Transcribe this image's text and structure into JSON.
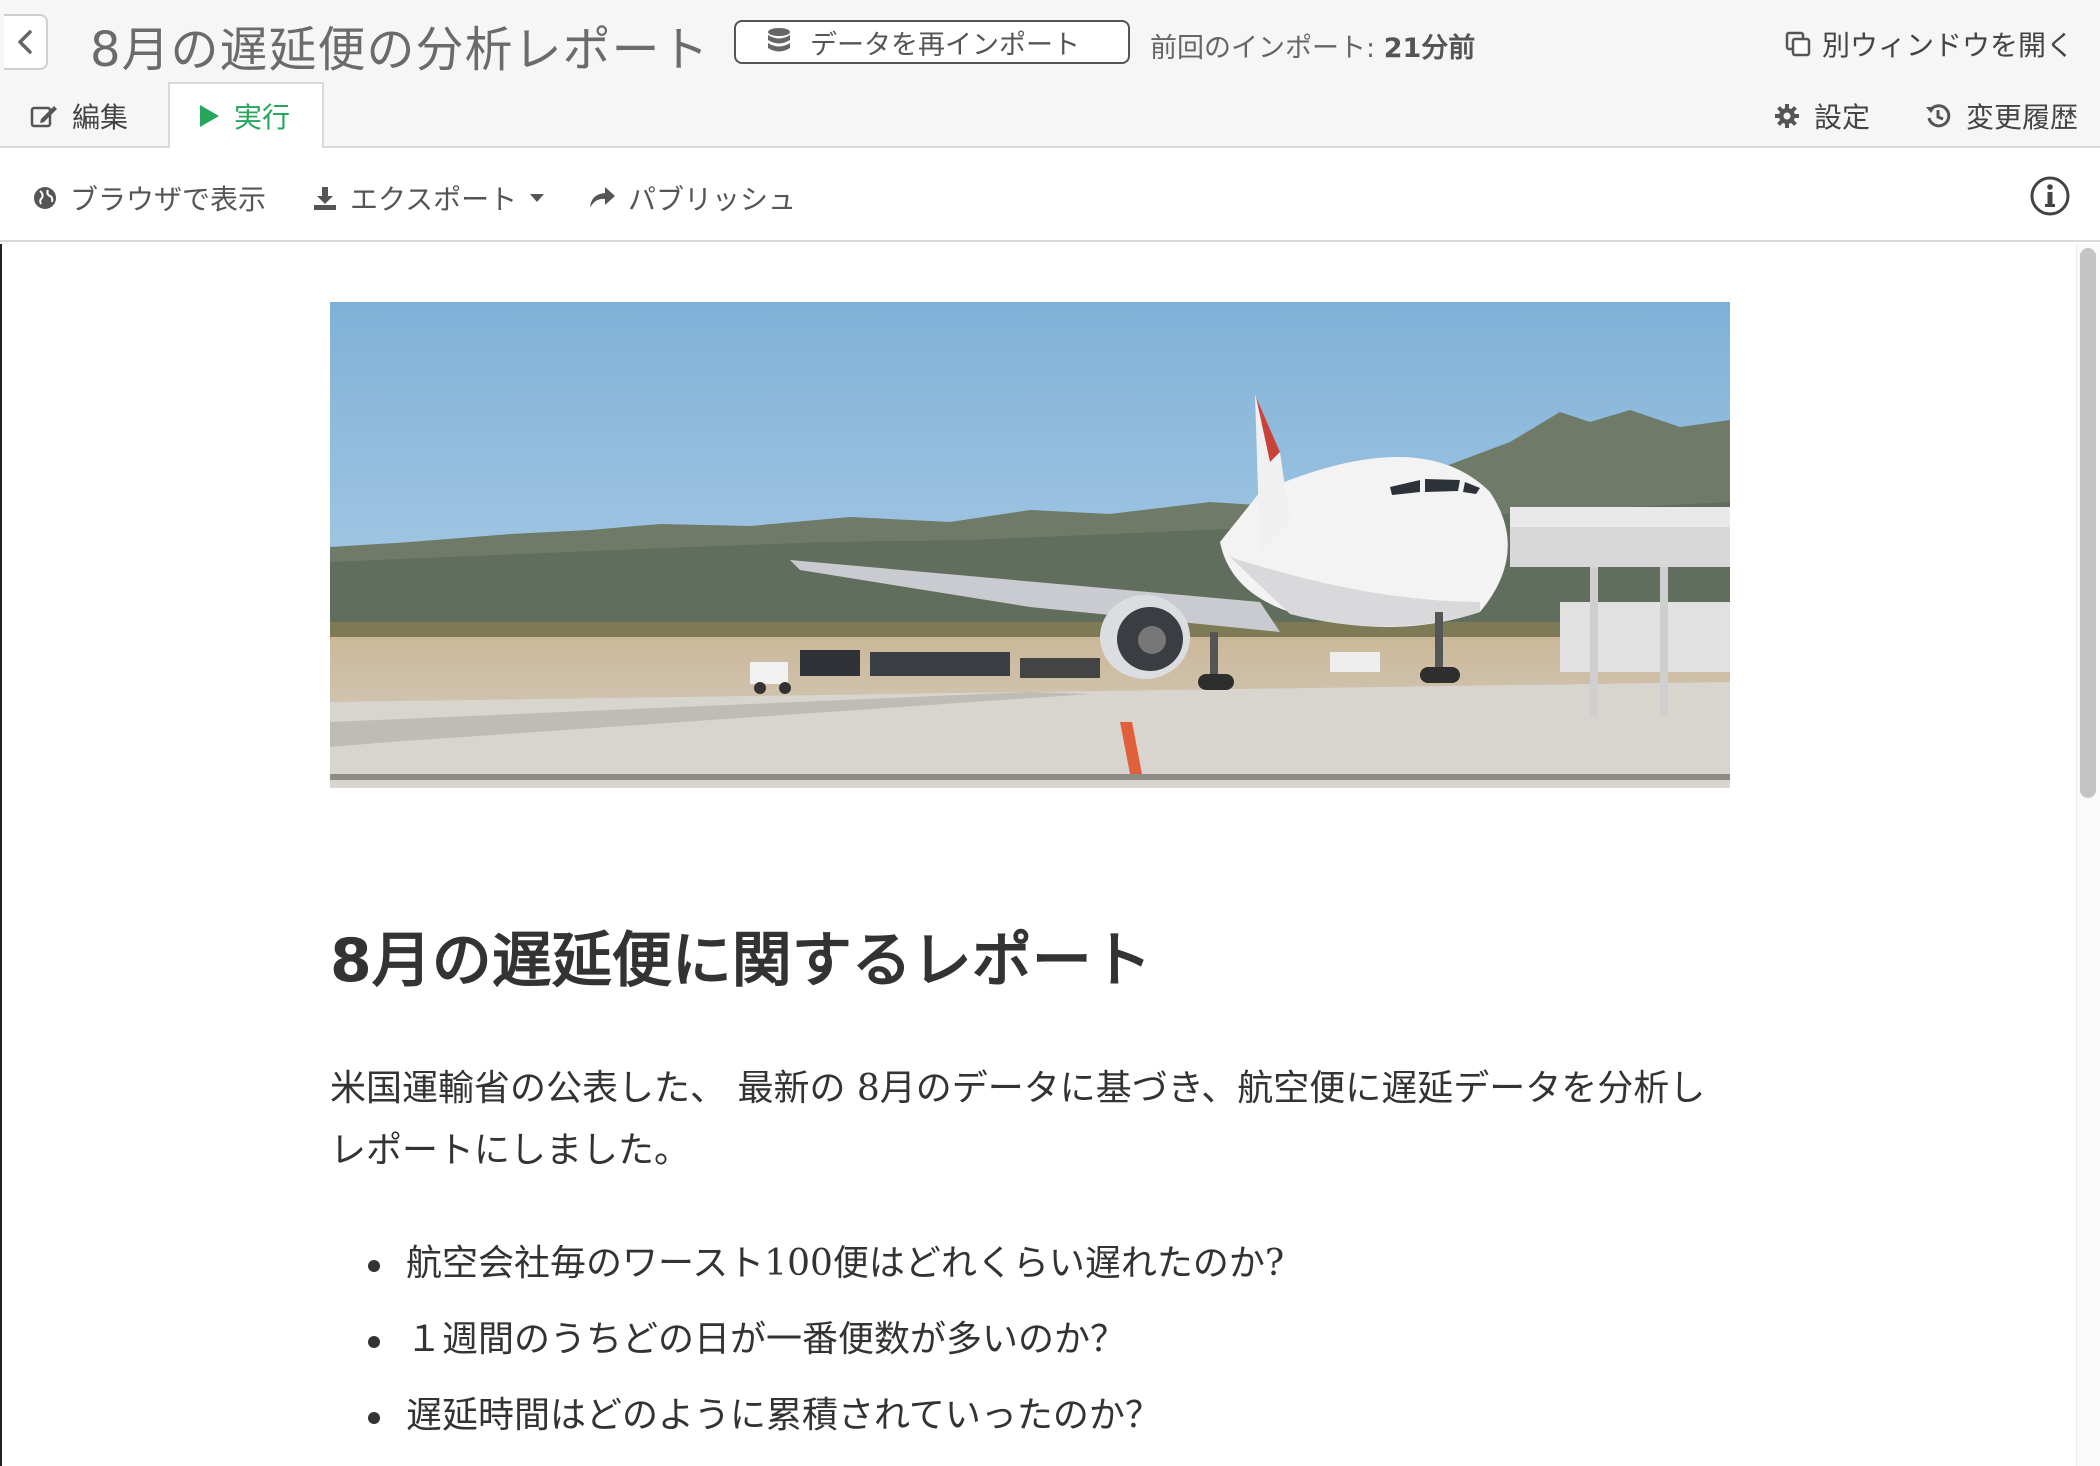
{
  "header": {
    "title": "8月の遅延便の分析レポート",
    "reimport_label": "データを再インポート",
    "last_import_label": "前回のインポート: ",
    "last_import_value": "21分前",
    "open_window_label": "別ウィンドウを開く"
  },
  "tabs": {
    "edit": "編集",
    "run": "実行",
    "settings": "設定",
    "history": "変更履歴"
  },
  "toolbar": {
    "browser": "ブラウザで表示",
    "export": "エクスポート",
    "publish": "パブリッシュ"
  },
  "report": {
    "heading": "8月の遅延便に関するレポート",
    "paragraph": "米国運輸省の公表した、 最新の 8月のデータに基づき、航空便に遅延データを分析しレポートにしました。",
    "bullets": [
      "航空会社毎のワースト100便はどれくらい遅れたのか?",
      "１週間のうちどの日が一番便数が多いのか？",
      "遅延時間はどのように累積されていったのか？"
    ]
  },
  "colors": {
    "accent": "#26a65b",
    "border": "#d9d9d9",
    "text": "#333333"
  },
  "icons": [
    "chevron-left-icon",
    "database-icon",
    "copy-window-icon",
    "edit-icon",
    "play-icon",
    "gear-icon",
    "history-icon",
    "globe-icon",
    "download-icon",
    "caret-down-icon",
    "share-icon",
    "info-icon"
  ]
}
